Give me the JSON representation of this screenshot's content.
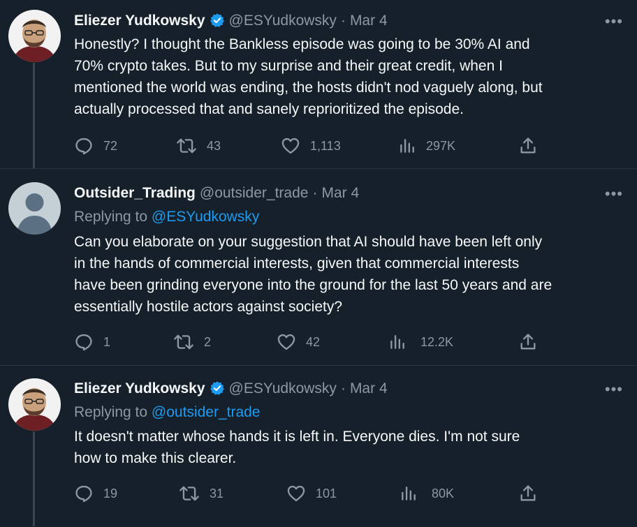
{
  "tweets": [
    {
      "name": "Eliezer Yudkowsky",
      "handle": "@ESYudkowsky",
      "sep": "·",
      "date": "Mar 4",
      "verified": true,
      "more_label": "•••",
      "replying_prefix": "",
      "replying_to": "",
      "lines": [
        "Honestly?  I thought the Bankless episode was going to be 30% AI and",
        "70% crypto takes.  But to my surprise and their great credit, when I",
        "mentioned the world was ending, the hosts didn't nod vaguely along, but",
        "actually processed that and sanely reprioritized the episode."
      ],
      "stats": {
        "replies": "72",
        "retweets": "43",
        "likes": "1,113",
        "views": "297K"
      }
    },
    {
      "name": "Outsider_Trading",
      "handle": "@outsider_trade",
      "sep": "·",
      "date": "Mar 4",
      "verified": false,
      "more_label": "•••",
      "replying_prefix": "Replying to ",
      "replying_to": "@ESYudkowsky",
      "lines": [
        "Can you elaborate on your suggestion that AI should have been left only",
        "in the hands of commercial interests, given that commercial interests",
        "have been grinding everyone into the ground for the last 50 years and are",
        "essentially hostile actors against society?"
      ],
      "stats": {
        "replies": "1",
        "retweets": "2",
        "likes": "42",
        "views": "12.2K"
      }
    },
    {
      "name": "Eliezer Yudkowsky",
      "handle": "@ESYudkowsky",
      "sep": "·",
      "date": "Mar 4",
      "verified": true,
      "more_label": "•••",
      "replying_prefix": "Replying to ",
      "replying_to": "@outsider_trade",
      "lines": [
        "It doesn't matter whose hands it is left in.  Everyone dies.  I'm not sure",
        "how to make this clearer."
      ],
      "stats": {
        "replies": "19",
        "retweets": "31",
        "likes": "101",
        "views": "80K"
      }
    }
  ],
  "colors": {
    "background": "#15202b",
    "text_primary": "#f7f9f9",
    "text_secondary": "#8b98a5",
    "accent": "#1d9bf0",
    "thread_line": "#3a4652"
  }
}
